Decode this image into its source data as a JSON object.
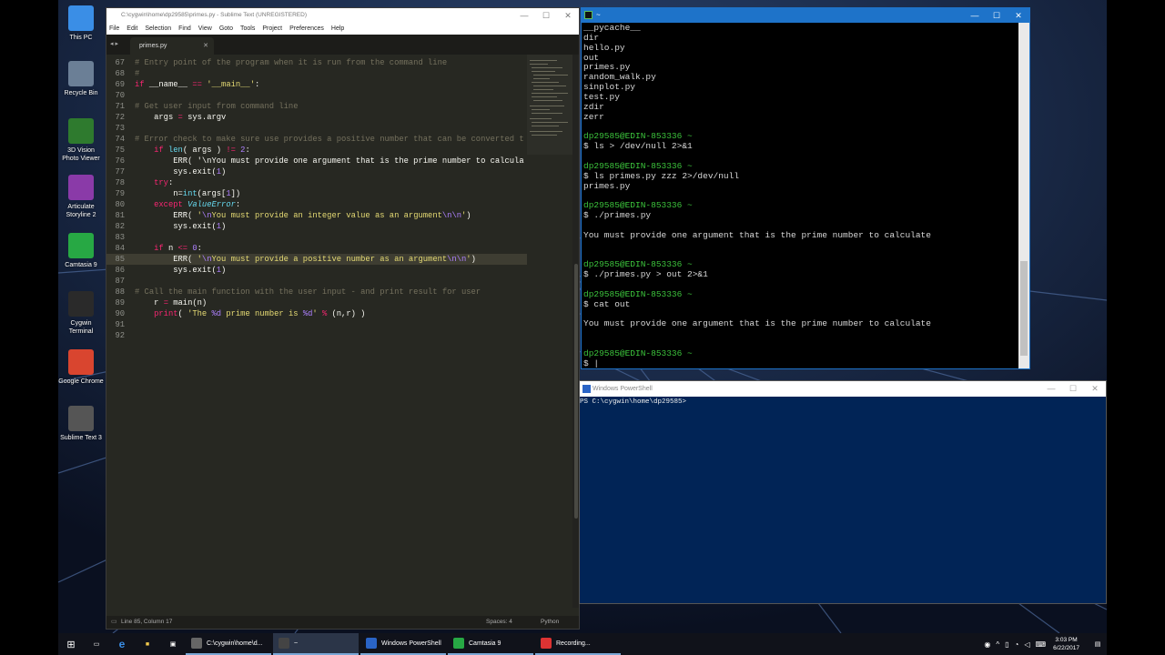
{
  "desktop": {
    "icons": [
      {
        "label": "This PC",
        "icon": "computer-icon",
        "color": "#3a8ee6"
      },
      {
        "label": "Recycle Bin",
        "icon": "recycle-bin-icon",
        "color": "#6b7f96"
      },
      {
        "label": "3D Vision Photo Viewer",
        "icon": "3d-vision-icon",
        "color": "#2e7a2e"
      },
      {
        "label": "Articulate Storyline 2",
        "icon": "storyline-icon",
        "color": "#8a3aa8"
      },
      {
        "label": "Camtasia 9",
        "icon": "camtasia-icon",
        "color": "#27a844"
      },
      {
        "label": "Cygwin Terminal",
        "icon": "cygwin-icon",
        "color": "#2a2a2a"
      },
      {
        "label": "Google Chrome",
        "icon": "chrome-icon",
        "color": "#d9452f"
      },
      {
        "label": "Sublime Text 3",
        "icon": "sublime-icon",
        "color": "#555"
      }
    ]
  },
  "sublime": {
    "title": "C:\\cygwin\\home\\dp29585\\primes.py - Sublime Text (UNREGISTERED)",
    "menu": [
      "File",
      "Edit",
      "Selection",
      "Find",
      "View",
      "Goto",
      "Tools",
      "Project",
      "Preferences",
      "Help"
    ],
    "tab": "primes.py",
    "line_numbers": [
      "67",
      "68",
      "69",
      "70",
      "71",
      "72",
      "73",
      "74",
      "75",
      "76",
      "77",
      "78",
      "79",
      "80",
      "81",
      "82",
      "83",
      "84",
      "85",
      "86",
      "87",
      "88",
      "89",
      "90",
      "91",
      "92"
    ],
    "code": [
      "# Entry point of the program when it is run from the command line",
      "#",
      "if __name__ == '__main__':",
      "",
      "# Get user input from command line",
      "    args = sys.argv",
      "",
      "# Error check to make sure use provides a positive number that can be converted t",
      "    if len( args ) != 2:",
      "        ERR( '\\nYou must provide one argument that is the prime number to calcula",
      "        sys.exit(1)",
      "    try:",
      "        n=int(args[1])",
      "    except ValueError:",
      "        ERR( '\\nYou must provide an integer value as an argument\\n\\n')",
      "        sys.exit(1)",
      "",
      "    if n <= 0:",
      "        ERR( '\\nYou must provide a positive number as an argument\\n\\n')",
      "        sys.exit(1)",
      "",
      "# Call the main function with the user input - and print result for user",
      "    r = main(n)",
      "    print( 'The %d prime number is %d' % (n,r) )",
      "",
      ""
    ],
    "status": {
      "position": "Line 85, Column 17",
      "spaces": "Spaces: 4",
      "syntax": "Python"
    }
  },
  "cygwin": {
    "title": "~",
    "lines": [
      {
        "t": "__pycache__",
        "c": "out"
      },
      {
        "t": "dir",
        "c": "out"
      },
      {
        "t": "hello.py",
        "c": "out"
      },
      {
        "t": "out",
        "c": "out"
      },
      {
        "t": "primes.py",
        "c": "out"
      },
      {
        "t": "random_walk.py",
        "c": "out"
      },
      {
        "t": "sinplot.py",
        "c": "out"
      },
      {
        "t": "test.py",
        "c": "out"
      },
      {
        "t": "zdir",
        "c": "out"
      },
      {
        "t": "zerr",
        "c": "out"
      },
      {
        "t": "",
        "c": "out"
      },
      {
        "t": "dp29585@EDIN-853336 ~",
        "c": "prompt"
      },
      {
        "t": "$ ls > /dev/null 2>&1",
        "c": "out"
      },
      {
        "t": "",
        "c": "out"
      },
      {
        "t": "dp29585@EDIN-853336 ~",
        "c": "prompt"
      },
      {
        "t": "$ ls primes.py zzz 2>/dev/null",
        "c": "out"
      },
      {
        "t": "primes.py",
        "c": "out"
      },
      {
        "t": "",
        "c": "out"
      },
      {
        "t": "dp29585@EDIN-853336 ~",
        "c": "prompt"
      },
      {
        "t": "$ ./primes.py",
        "c": "out"
      },
      {
        "t": "",
        "c": "out"
      },
      {
        "t": "You must provide one argument that is the prime number to calculate",
        "c": "out"
      },
      {
        "t": "",
        "c": "out"
      },
      {
        "t": "",
        "c": "out"
      },
      {
        "t": "dp29585@EDIN-853336 ~",
        "c": "prompt"
      },
      {
        "t": "$ ./primes.py > out 2>&1",
        "c": "out"
      },
      {
        "t": "",
        "c": "out"
      },
      {
        "t": "dp29585@EDIN-853336 ~",
        "c": "prompt"
      },
      {
        "t": "$ cat out",
        "c": "out"
      },
      {
        "t": "",
        "c": "out"
      },
      {
        "t": "You must provide one argument that is the prime number to calculate",
        "c": "out"
      },
      {
        "t": "",
        "c": "out"
      },
      {
        "t": "",
        "c": "out"
      },
      {
        "t": "dp29585@EDIN-853336 ~",
        "c": "prompt"
      },
      {
        "t": "$ |",
        "c": "out"
      }
    ]
  },
  "powershell": {
    "title": "Windows PowerShell",
    "prompt": "PS C:\\cygwin\\home\\dp29585>"
  },
  "taskbar": {
    "apps": [
      {
        "label": "C:\\cygwin\\home\\d...",
        "icon": "sublime-icon",
        "color": "#666"
      },
      {
        "label": "~",
        "icon": "cygwin-icon",
        "color": "#444"
      },
      {
        "label": "Windows PowerShell",
        "icon": "powershell-icon",
        "color": "#2a64c6"
      },
      {
        "label": "Camtasia 9",
        "icon": "camtasia-icon",
        "color": "#27a844"
      },
      {
        "label": "Recording...",
        "icon": "record-icon",
        "color": "#d33"
      }
    ],
    "time": "3:03 PM",
    "date": "6/22/2017"
  }
}
